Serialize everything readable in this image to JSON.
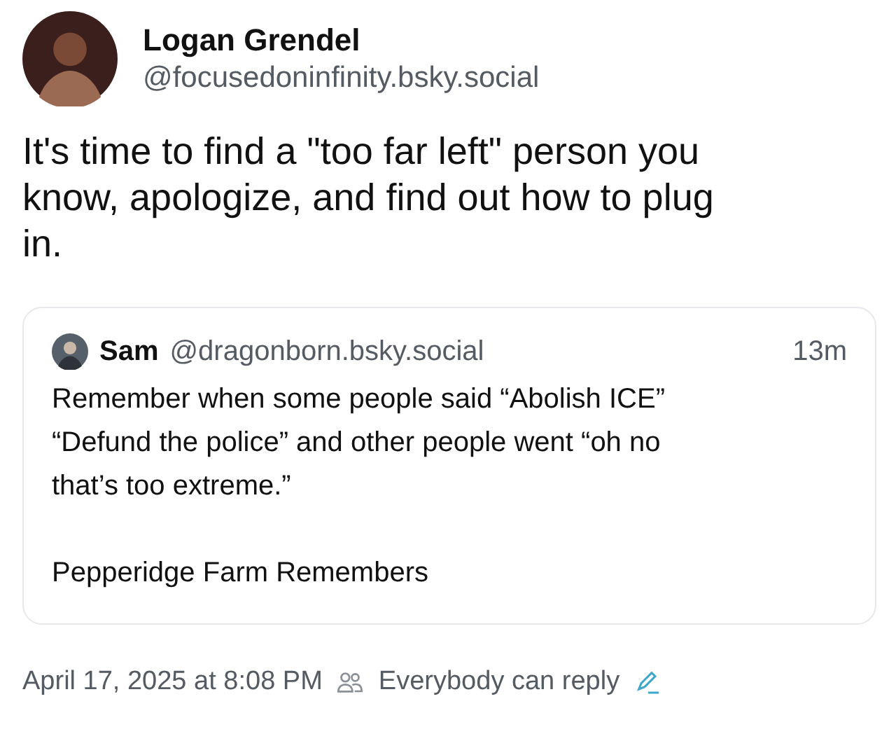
{
  "post": {
    "author": {
      "name": "Logan Grendel",
      "handle": "@focusedoninfinity.bsky.social"
    },
    "text": "It's time to find a \"too far left\" person you know, apologize, and find out how to plug in.",
    "quote": {
      "author": {
        "name": "Sam",
        "handle": "@dragonborn.bsky.social"
      },
      "time": "13m",
      "paragraphs": [
        "Remember when some people said “Abolish ICE” “Defund the police” and other people went “oh no that’s too extreme.”",
        "Pepperidge Farm Remembers"
      ]
    },
    "timestamp": "April 17, 2025 at 8:08 PM",
    "reply_setting": "Everybody can reply"
  }
}
